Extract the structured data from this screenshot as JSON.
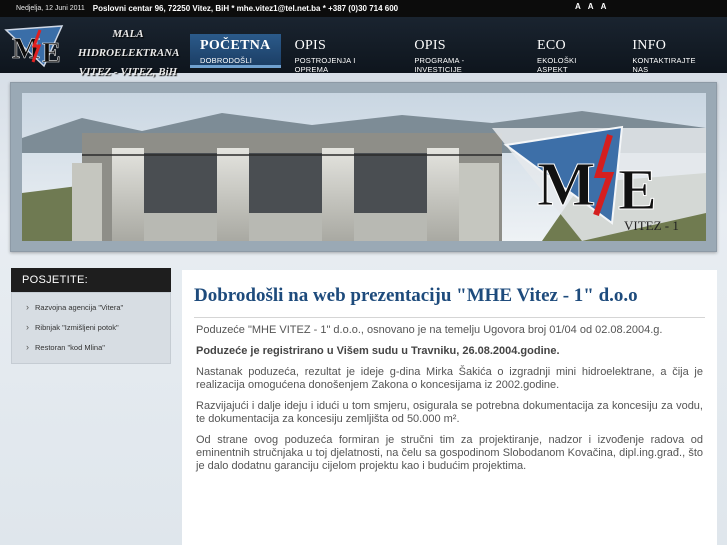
{
  "topbar": {
    "date": "Nedjelja, 12 Juni 2011",
    "contact": "Poslovni centar 96, 72250 Vitez, BiH * mhe.vitez1@tel.net.ba * +387 (0)30 714 600",
    "font_sizes": [
      "A",
      "A",
      "A"
    ]
  },
  "logo": {
    "mark": "M/E",
    "line1": "MALA HIDROELEKTRANA",
    "line2": "VITEZ - VITEZ, BiH"
  },
  "nav": [
    {
      "title": "POČETNA",
      "sub": "DOBRODOŠLI",
      "active": true
    },
    {
      "title": "OPIS",
      "sub": "POSTROJENJA I OPREMA",
      "active": false
    },
    {
      "title": "OPIS",
      "sub": "PROGRAMA - INVESTICIJE",
      "active": false
    },
    {
      "title": "ECO",
      "sub": "EKOLOŠKI ASPEKT",
      "active": false
    },
    {
      "title": "INFO",
      "sub": "KONTAKTIRAJTE NAS",
      "active": false
    }
  ],
  "banner": {
    "logo_mark": "M/E",
    "logo_sub": "VITEZ - 1"
  },
  "sidebar": {
    "heading": "POSJETITE:",
    "items": [
      "Razvojna agencija \"Vitera\"",
      "Ribnjak \"Izmišljeni potok\"",
      "Restoran \"kod Mlina\""
    ]
  },
  "content": {
    "heading": "Dobrodošli na web prezentaciju \"MHE Vitez - 1\" d.o.o",
    "p1": "Poduzeće \"MHE VITEZ - 1\" d.o.o., osnovano je na temelju Ugovora broj 01/04 od 02.08.2004.g.",
    "p2": "Poduzeće je registrirano u Višem sudu u Travniku, 26.08.2004.godine.",
    "p3": "Nastanak poduzeća, rezultat je ideje g-dina Mirka Šakića o izgradnji mini hidroelektrane, a čija je realizacija omogućena donošenjem Zakona o koncesijama iz 2002.godine.",
    "p4": "Razvijajući i dalje ideju i idući u tom smjeru, osigurala se potrebna dokumentacija za koncesiju za vodu, te dokumentacija za koncesiju zemljišta od 50.000 m².",
    "p5": "Od strane ovog poduzeća formiran je stručni tim za projektiranje, nadzor i izvođenje radova od eminentnih stručnjaka u toj djelatnosti, na čelu sa gospodinom Slobodanom Kovačina, dipl.ing.građ., što je dalo dodatnu garanciju cijelom projektu kao i budućim projektima."
  },
  "colors": {
    "accent": "#1e4b7c",
    "nav_active": "#2b5a8a",
    "header_bg": "#0e151d"
  }
}
